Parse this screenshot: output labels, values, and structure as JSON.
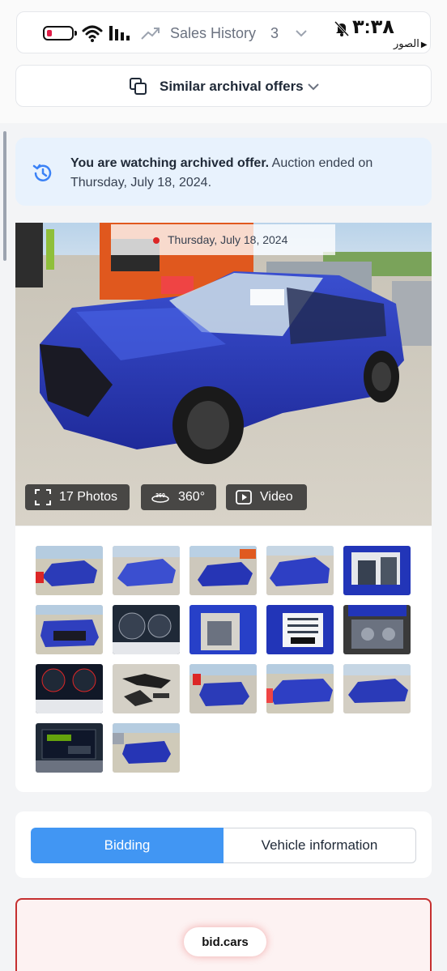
{
  "status_bar": {
    "sales_history_label": "Sales History",
    "sales_history_count": "3",
    "clock": "٣:٣٨",
    "back_label": "الصور"
  },
  "similar_offers": {
    "label": "Similar archival offers"
  },
  "notice": {
    "bold": "You are watching archived offer.",
    "text": " Auction ended on Thursday, July 18, 2024."
  },
  "photo": {
    "date": "Thursday, July 18, 2024",
    "photos_label": "17 Photos",
    "view360_label": "360°",
    "video_label": "Video"
  },
  "tabs": {
    "bidding": "Bidding",
    "vehicle_info": "Vehicle information"
  },
  "bid_card": {
    "logo": "bid.cars"
  },
  "colors": {
    "accent": "#4196f3",
    "notice_bg": "#e8f2fd",
    "alert_border": "#c53030"
  },
  "thumbnails_count": 17
}
